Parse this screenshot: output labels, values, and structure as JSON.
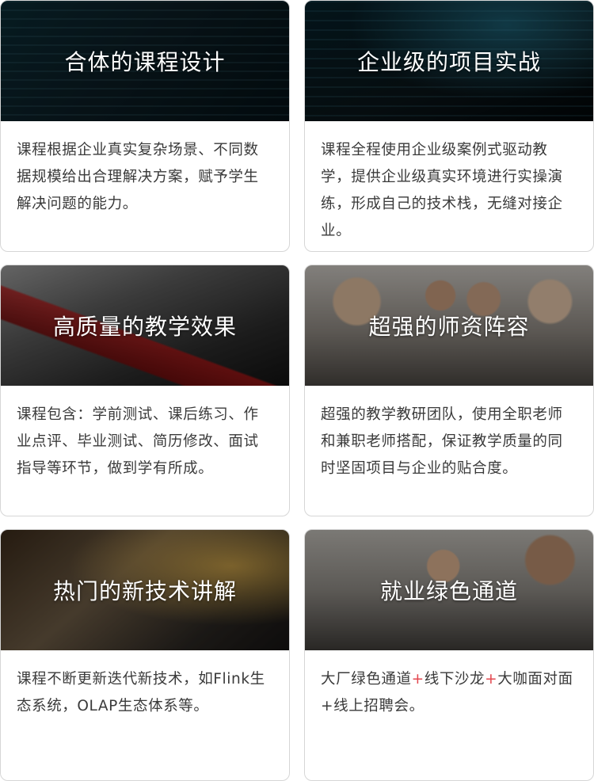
{
  "cards": [
    {
      "title": "合体的课程设计",
      "body": "课程根据企业真实复杂场景、不同数据规模给出合理解决方案，赋予学生解决问题的能力。"
    },
    {
      "title": "企业级的项目实战",
      "body": "课程全程使用企业级案例式驱动教学，提供企业级真实环境进行实操演练，形成自己的技术栈，无缝对接企业。"
    },
    {
      "title": "高质量的教学效果",
      "body": "课程包含：学前测试、课后练习、作业点评、毕业测试、简历修改、面试指导等环节，做到学有所成。"
    },
    {
      "title": "超强的师资阵容",
      "body": "超强的教学教研团队，使用全职老师和兼职老师搭配，保证教学质量的同时坚固项目与企业的贴合度。"
    },
    {
      "title": "热门的新技术讲解",
      "body": "课程不断更新迭代新技术，如Flink生态系统，OLAP生态体系等。"
    },
    {
      "title": "就业绿色通道",
      "body_parts": [
        "大厂绿色通道",
        "+",
        "线下沙龙",
        "+",
        "大咖面对面",
        "+线上招聘会。"
      ]
    }
  ],
  "colors": {
    "plus_accent": "#e3474f",
    "body_text": "#3a3a3a",
    "title_text": "#ffffff"
  }
}
